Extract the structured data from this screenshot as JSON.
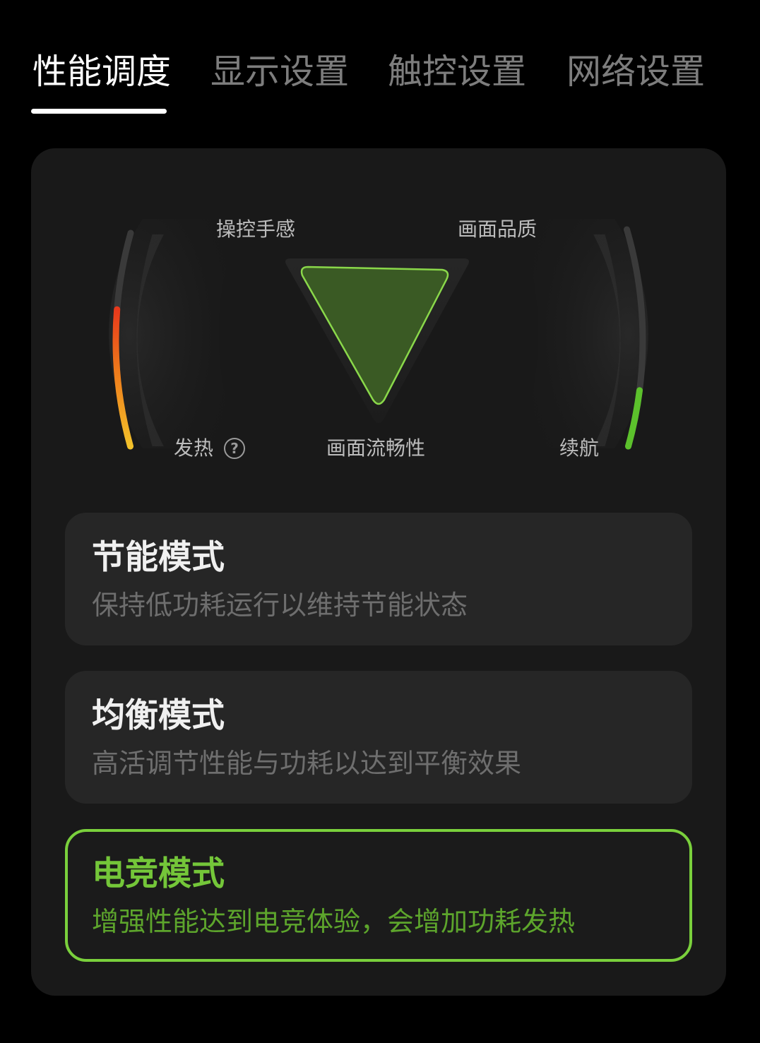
{
  "tabs": [
    {
      "label": "性能调度",
      "active": true
    },
    {
      "label": "显示设置",
      "active": false
    },
    {
      "label": "触控设置",
      "active": false
    },
    {
      "label": "网络设置",
      "active": false
    }
  ],
  "gauge": {
    "labels": {
      "control": "操控手感",
      "quality": "画面品质",
      "heat": "发热",
      "fluency": "画面流畅性",
      "battery": "续航"
    },
    "help_icon": "?",
    "heat_level": 0.64,
    "battery_level": 0.26,
    "colors": {
      "heat_start": "#f2c12a",
      "heat_mid": "#ef7a1b",
      "heat_end": "#e8391b",
      "battery": "#5cc12c",
      "triangle_fill": "#3a5a24",
      "triangle_stroke": "#8ad84a",
      "track": "#3a3a3a"
    }
  },
  "modes": [
    {
      "title": "节能模式",
      "desc": "保持低功耗运行以维持节能状态",
      "selected": false
    },
    {
      "title": "均衡模式",
      "desc": "高活调节性能与功耗以达到平衡效果",
      "selected": false
    },
    {
      "title": "电竞模式",
      "desc": "增强性能达到电竞体验，会增加功耗发热",
      "selected": true
    }
  ],
  "accent_color": "#7ad03c"
}
